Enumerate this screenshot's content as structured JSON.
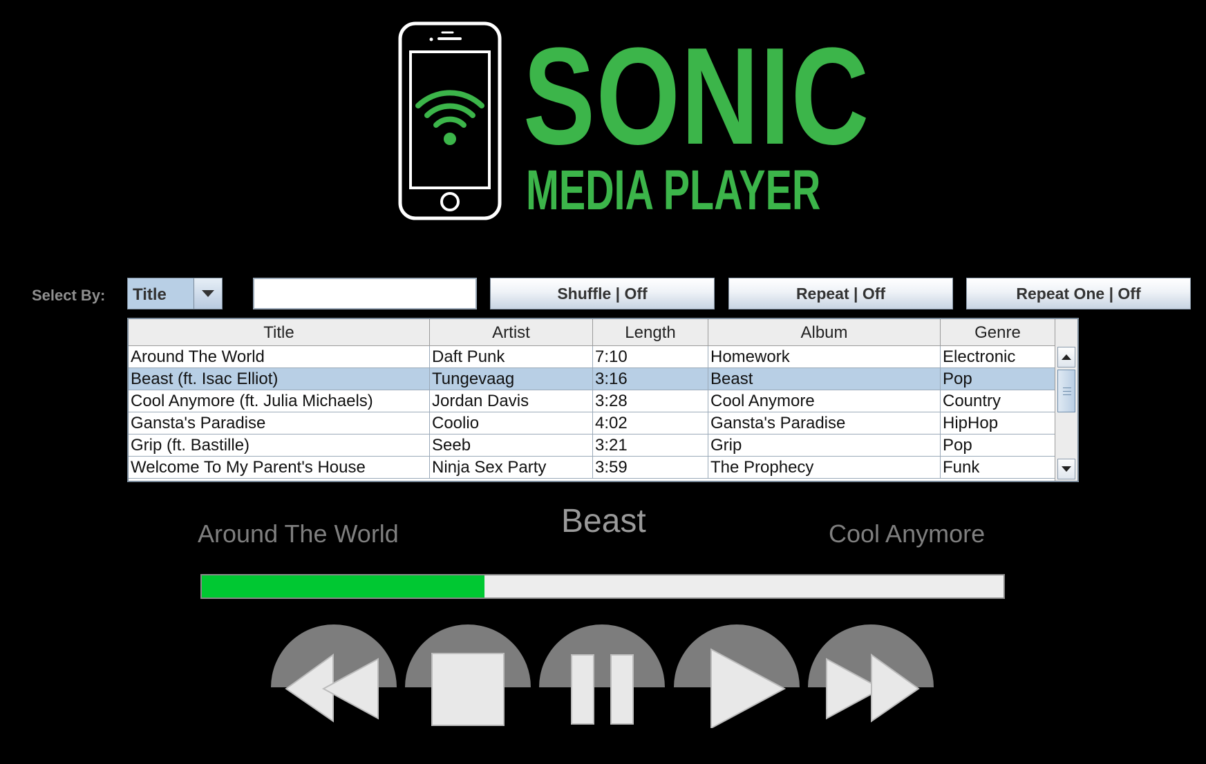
{
  "logo": {
    "title": "SONIC",
    "subtitle": "MEDIA PLAYER",
    "brand_color": "#3cb54a",
    "icon": "smartphone-wifi-icon"
  },
  "controls": {
    "select_by_label": "Select By:",
    "select_value": "Title",
    "search_value": "",
    "search_placeholder": "",
    "shuffle_label": "Shuffle | Off",
    "repeat_label": "Repeat | Off",
    "repeat_one_label": "Repeat One | Off"
  },
  "table": {
    "columns": [
      "Title",
      "Artist",
      "Length",
      "Album",
      "Genre"
    ],
    "selected_index": 1,
    "rows": [
      [
        "Around The World",
        "Daft Punk",
        "7:10",
        "Homework",
        "Electronic"
      ],
      [
        "Beast (ft. Isac Elliot)",
        "Tungevaag",
        "3:16",
        "Beast",
        "Pop"
      ],
      [
        "Cool Anymore (ft. Julia Michaels)",
        "Jordan Davis",
        "3:28",
        "Cool Anymore",
        "Country"
      ],
      [
        "Gansta's Paradise",
        "Coolio",
        "4:02",
        "Gansta's Paradise",
        "HipHop"
      ],
      [
        "Grip (ft. Bastille)",
        "Seeb",
        "3:21",
        "Grip",
        "Pop"
      ],
      [
        "Welcome To My Parent's House",
        "Ninja Sex Party",
        "3:59",
        "The Prophecy",
        "Funk"
      ]
    ],
    "selected_row_color": "#b8cfe5"
  },
  "now_playing": {
    "previous": "Around The World",
    "current": "Beast",
    "next": "Cool Anymore",
    "progress_fraction": 0.353,
    "progress_color": "#00c832"
  },
  "transport": {
    "icons": [
      "rewind-icon",
      "stop-icon",
      "pause-icon",
      "play-icon",
      "fast-forward-icon"
    ]
  }
}
